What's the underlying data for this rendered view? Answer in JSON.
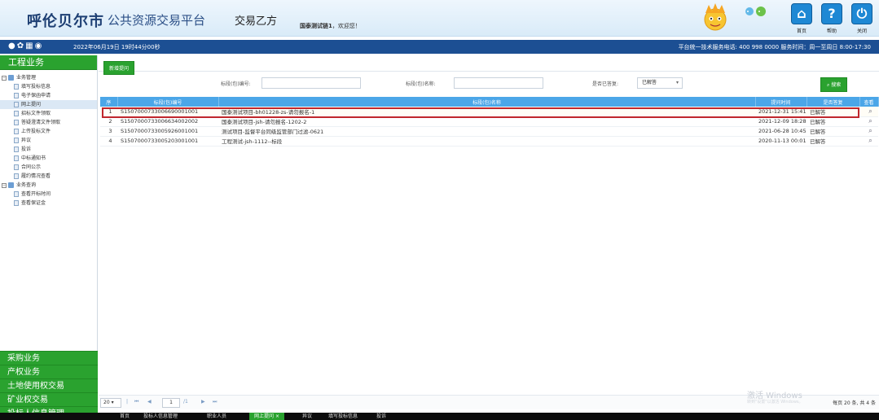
{
  "header": {
    "brand": "呼伦贝尔市",
    "brand_sub": "公共资源交易平台",
    "party": "交易乙方",
    "welcome_user": "国泰测试链1",
    "welcome_tail": "，欢迎您！",
    "buttons": [
      {
        "icon": "home-icon",
        "label": "首页"
      },
      {
        "icon": "help-icon",
        "label": "帮助"
      },
      {
        "icon": "power-icon",
        "label": "关闭"
      }
    ]
  },
  "infobar": {
    "date": "2022年06月19日 19时44分00秒",
    "service": "平台统一技术服务电话: 400 998 0000 服务时间：周一至周日 8:00-17:30"
  },
  "nav": {
    "head": "工程业务",
    "tree": [
      {
        "type": "group",
        "label": "业务管理"
      },
      {
        "type": "leaf",
        "label": "填写投标信息"
      },
      {
        "type": "leaf",
        "label": "电子保函申请"
      },
      {
        "type": "leaf",
        "label": "网上提问",
        "active": true
      },
      {
        "type": "leaf",
        "label": "招标文件领取"
      },
      {
        "type": "leaf",
        "label": "答疑澄清文件领取"
      },
      {
        "type": "leaf",
        "label": "上传投标文件"
      },
      {
        "type": "leaf",
        "label": "异议"
      },
      {
        "type": "leaf",
        "label": "投诉"
      },
      {
        "type": "leaf",
        "label": "中标通知书"
      },
      {
        "type": "leaf",
        "label": "合同公示"
      },
      {
        "type": "leaf",
        "label": "履约情况查看"
      },
      {
        "type": "group",
        "label": "业务查询"
      },
      {
        "type": "leaf",
        "label": "查看开标时间"
      },
      {
        "type": "leaf",
        "label": "查看保证金"
      }
    ],
    "sections": [
      "采购业务",
      "产权业务",
      "土地使用权交易",
      "矿业权交易",
      "投标人信息管理"
    ]
  },
  "main": {
    "new_button": "新增提问",
    "filters": {
      "code_label": "标段(包)编号:",
      "name_label": "标段(包)名称:",
      "answered_label": "是否已答复:",
      "answered_value": "已解答",
      "search": "搜索"
    },
    "columns": [
      "序",
      "标段(包)编号",
      "标段(包)名称",
      "提问时间",
      "是否答复",
      "查看"
    ],
    "rows": [
      {
        "no": "1",
        "code": "S1507000733006690001001",
        "name": "国泰测试项目-bh01228-zs-请勿报名-1",
        "time": "2021-12-31 15:41",
        "status": "已解答"
      },
      {
        "no": "2",
        "code": "S1507000733006634002002",
        "name": "国泰测试项目-jsh-请勿报名-1202-2",
        "time": "2021-12-09 18:28",
        "status": "已解答"
      },
      {
        "no": "3",
        "code": "S1507000733005926001001",
        "name": "测试项目-监督平台同级监管部门过滤-0621",
        "time": "2021-06-28 10:45",
        "status": "已解答"
      },
      {
        "no": "4",
        "code": "S1507000733005203001001",
        "name": "工程测试-jsh-1112--标段",
        "time": "2020-11-13 00:01",
        "status": "已解答"
      }
    ]
  },
  "pager": {
    "page_size": "20",
    "current_page": "1",
    "total_pages": "/1",
    "info": "每页 20 条, 共 4 条"
  },
  "watermark": {
    "line1": "激活 Windows",
    "line2": "转到\"设置\"以激活 Windows。"
  },
  "tabs": [
    "首页",
    "投标人信息管理",
    "职业人员",
    "网上提问",
    "异议",
    "填写投标信息",
    "投诉"
  ],
  "active_tab": "网上提问"
}
